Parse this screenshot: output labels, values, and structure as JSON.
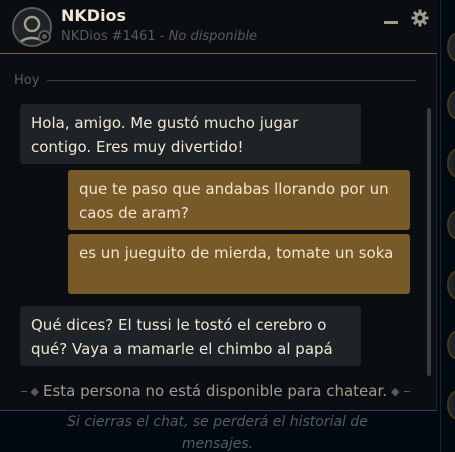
{
  "chat": {
    "contact_name": "NKDios",
    "riot_tag": "NKDios #1461",
    "status": "No disponible",
    "day_label": "Hoy",
    "messages": [
      {
        "direction": "in",
        "text": "Hola, amigo. Me gustó mucho jugar contigo. Eres muy divertido!"
      },
      {
        "direction": "out",
        "text": "que te paso que andabas llorando por un caos de aram?"
      },
      {
        "direction": "out",
        "text": "es un jueguito de mierda, tomate un soka"
      },
      {
        "direction": "in",
        "text": "Qué dices? El tussi le tostó el cerebro o qué? Vaya a mamarle el chimbo al papá"
      }
    ],
    "unavailable_notice": "Esta persona no está disponible para chatear.",
    "input_placeholder": "Si cierras el chat, se perderá el historial de mensajes."
  },
  "icons": {
    "minimize": "minimize-icon",
    "settings": "gear-icon",
    "avatar": "user-avatar-icon"
  },
  "colors": {
    "accent_gold": "#785a28",
    "incoming_bubble": "#1e2328",
    "text_light": "#f0e6d2",
    "muted": "#5b5a56"
  }
}
